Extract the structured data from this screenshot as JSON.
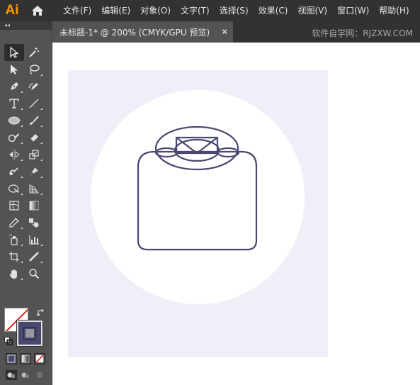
{
  "app": {
    "logo_text": "Ai"
  },
  "menu": {
    "items": [
      "文件(F)",
      "编辑(E)",
      "对象(O)",
      "文字(T)",
      "选择(S)",
      "效果(C)",
      "视图(V)",
      "窗口(W)",
      "帮助(H)"
    ]
  },
  "tools_panel": {
    "collapse_glyph": "◂◂"
  },
  "document_tab": {
    "title": "未标题-1* @ 200% (CMYK/GPU 预览)",
    "close_glyph": "×"
  },
  "watermark": "软件自学网：RJZXW.COM",
  "colors": {
    "accent_logo": "#ff9a00",
    "menubar_bg": "#323232",
    "panel_bg": "#535353",
    "artboard_bg": "#efeff8",
    "circle_fill": "#ffffff",
    "stroke_color": "#484870"
  },
  "tools": [
    [
      "selection-tool",
      "magic-wand-tool"
    ],
    [
      "direct-selection-tool",
      "lasso-tool"
    ],
    [
      "pen-tool",
      "curvature-tool"
    ],
    [
      "type-tool",
      "line-tool"
    ],
    [
      "ellipse-tool",
      "paintbrush-tool"
    ],
    [
      "shaper-tool",
      "eraser-tool"
    ],
    [
      "reflect-tool",
      "scale-tool"
    ],
    [
      "warp-tool",
      "puppet-warp-tool"
    ],
    [
      "shape-builder-tool",
      "perspective-grid-tool"
    ],
    [
      "mesh-tool",
      "gradient-tool"
    ],
    [
      "eyedropper-tool",
      "blend-tool"
    ],
    [
      "symbol-sprayer-tool",
      "column-graph-tool"
    ],
    [
      "artboard-tool",
      "slice-tool"
    ],
    [
      "hand-tool",
      "zoom-tool"
    ]
  ],
  "icons": {
    "home": "home-icon",
    "swap": "swap-fill-stroke-icon",
    "close": "close-icon"
  }
}
